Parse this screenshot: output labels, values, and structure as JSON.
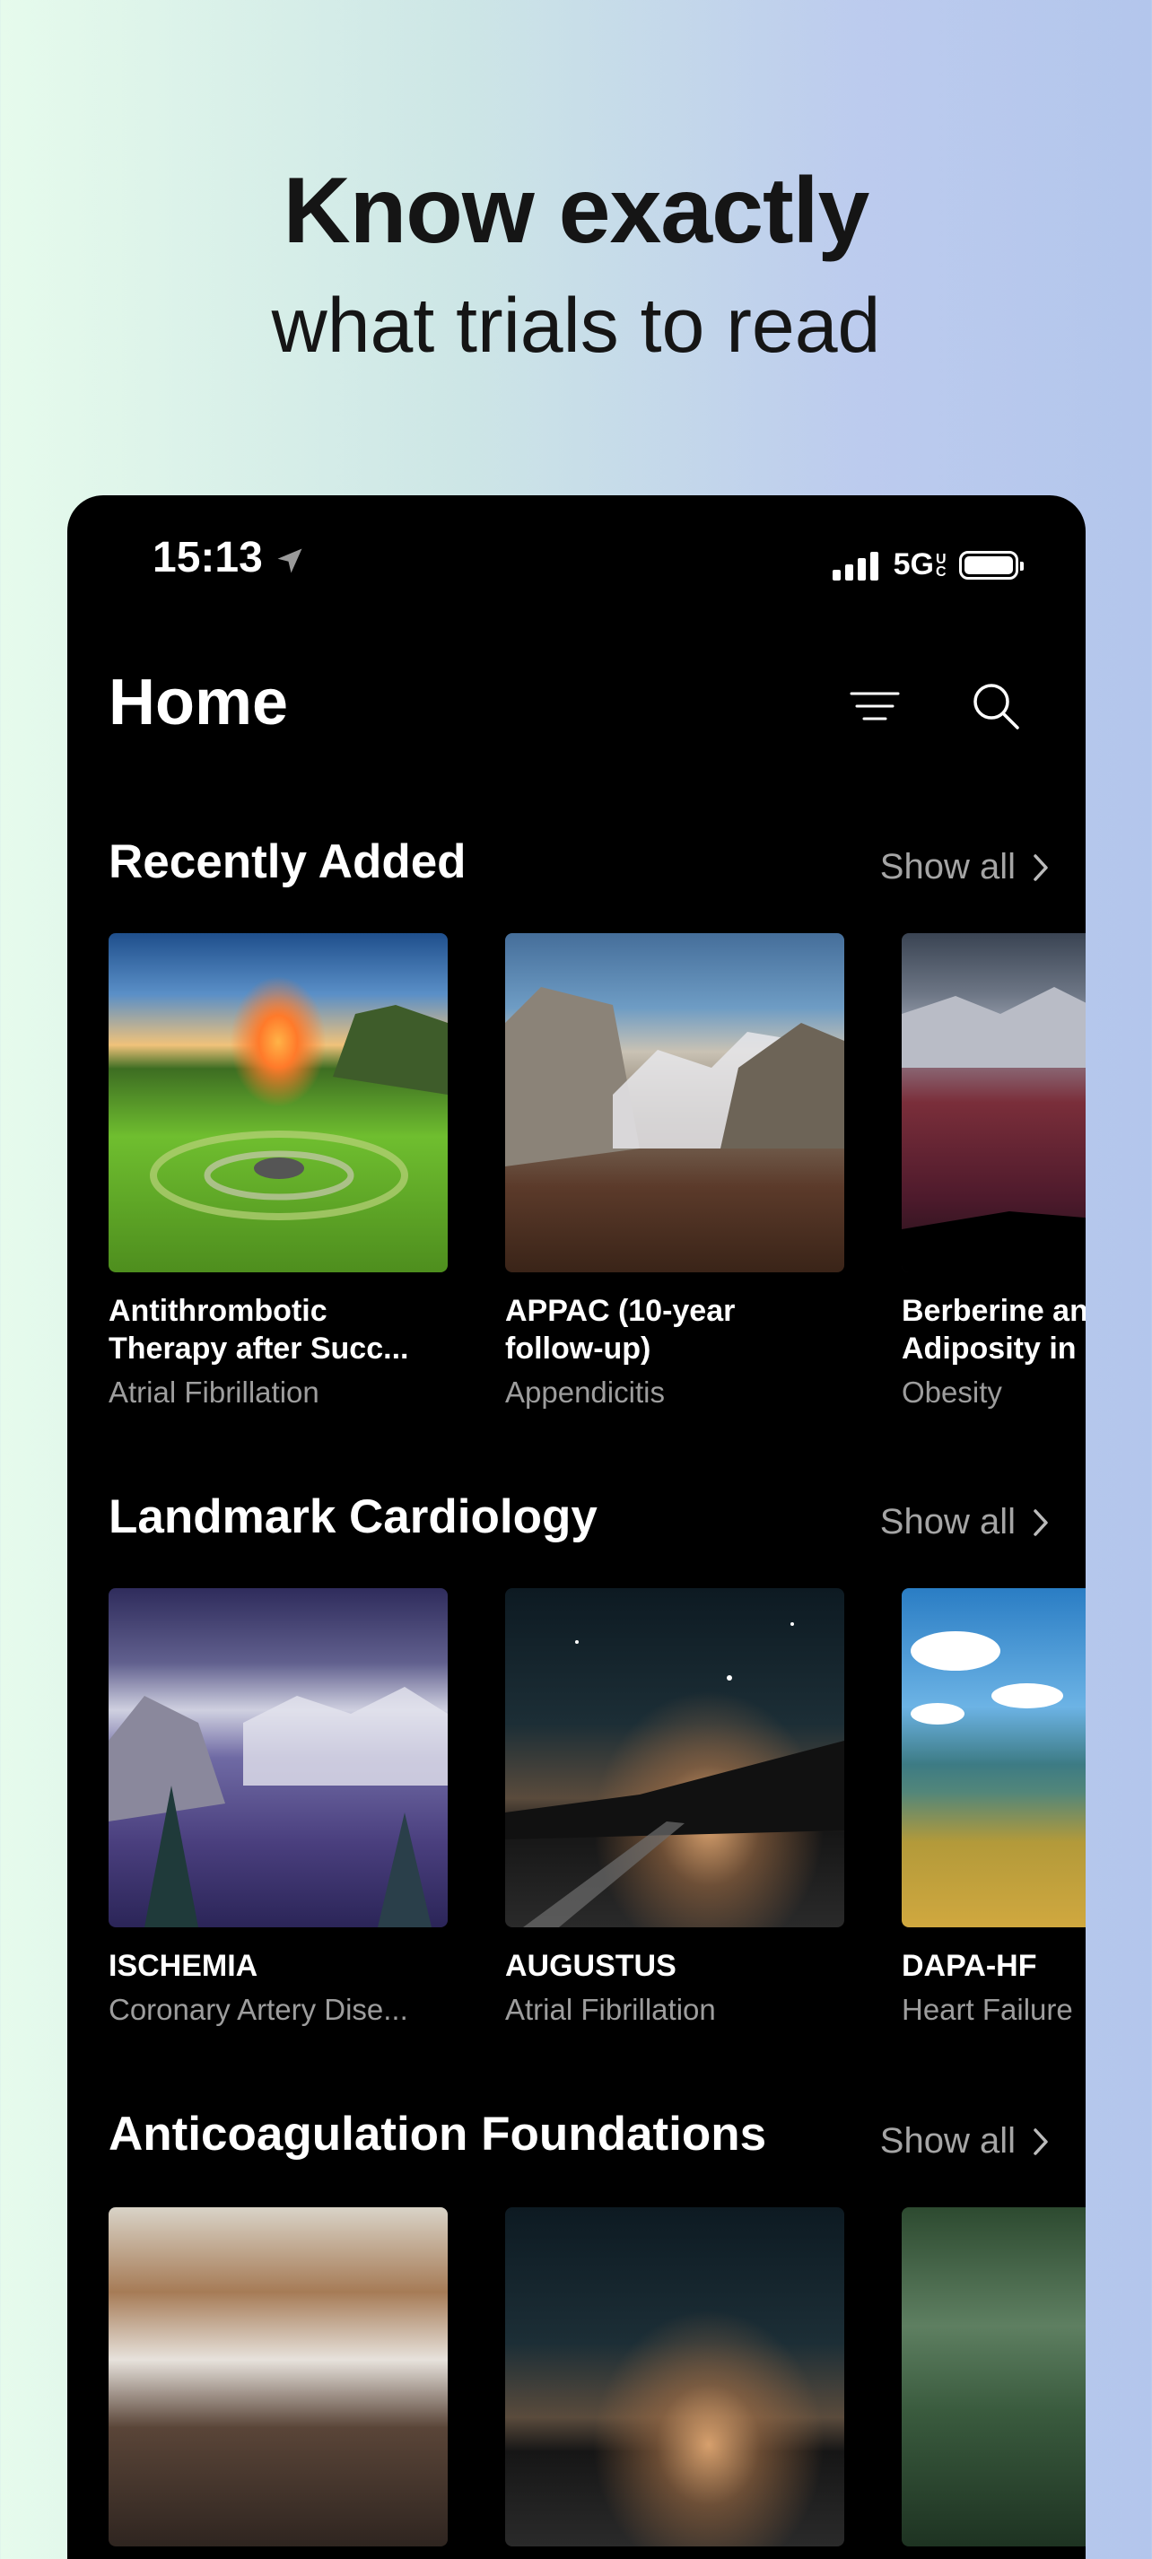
{
  "hero": {
    "title": "Know exactly",
    "subtitle": "what trials to read"
  },
  "status_bar": {
    "time": "15:13",
    "network": "5G",
    "network_suffix": "UC"
  },
  "header": {
    "title": "Home",
    "filter_icon": "filter-lines-icon",
    "search_icon": "search-icon"
  },
  "show_all_label": "Show all",
  "sections": [
    {
      "title": "Recently Added",
      "cards": [
        {
          "title": "Antithrombotic\nTherapy after Succ...",
          "subtitle": "Atrial Fibrillation",
          "image": "green-valley-sunset"
        },
        {
          "title": "APPAC (10-year\nfollow-up)",
          "subtitle": "Appendicitis",
          "image": "yosemite-valley"
        },
        {
          "title": "Berberine and\nAdiposity in",
          "subtitle": "Obesity",
          "image": "red-mountains"
        }
      ]
    },
    {
      "title": "Landmark Cardiology",
      "cards": [
        {
          "title": "ISCHEMIA",
          "subtitle": "Coronary Artery Dise...",
          "image": "snowy-valley"
        },
        {
          "title": "AUGUSTUS",
          "subtitle": "Atrial Fibrillation",
          "image": "starry-road"
        },
        {
          "title": "DAPA-HF",
          "subtitle": "Heart Failure",
          "image": "sea-meadow"
        }
      ]
    },
    {
      "title": "Anticoagulation Foundations",
      "cards": [
        {
          "title": "",
          "subtitle": "",
          "image": "snowy-hills"
        },
        {
          "title": "",
          "subtitle": "",
          "image": "starry-sky"
        },
        {
          "title": "",
          "subtitle": "",
          "image": "forest-river"
        }
      ]
    }
  ]
}
